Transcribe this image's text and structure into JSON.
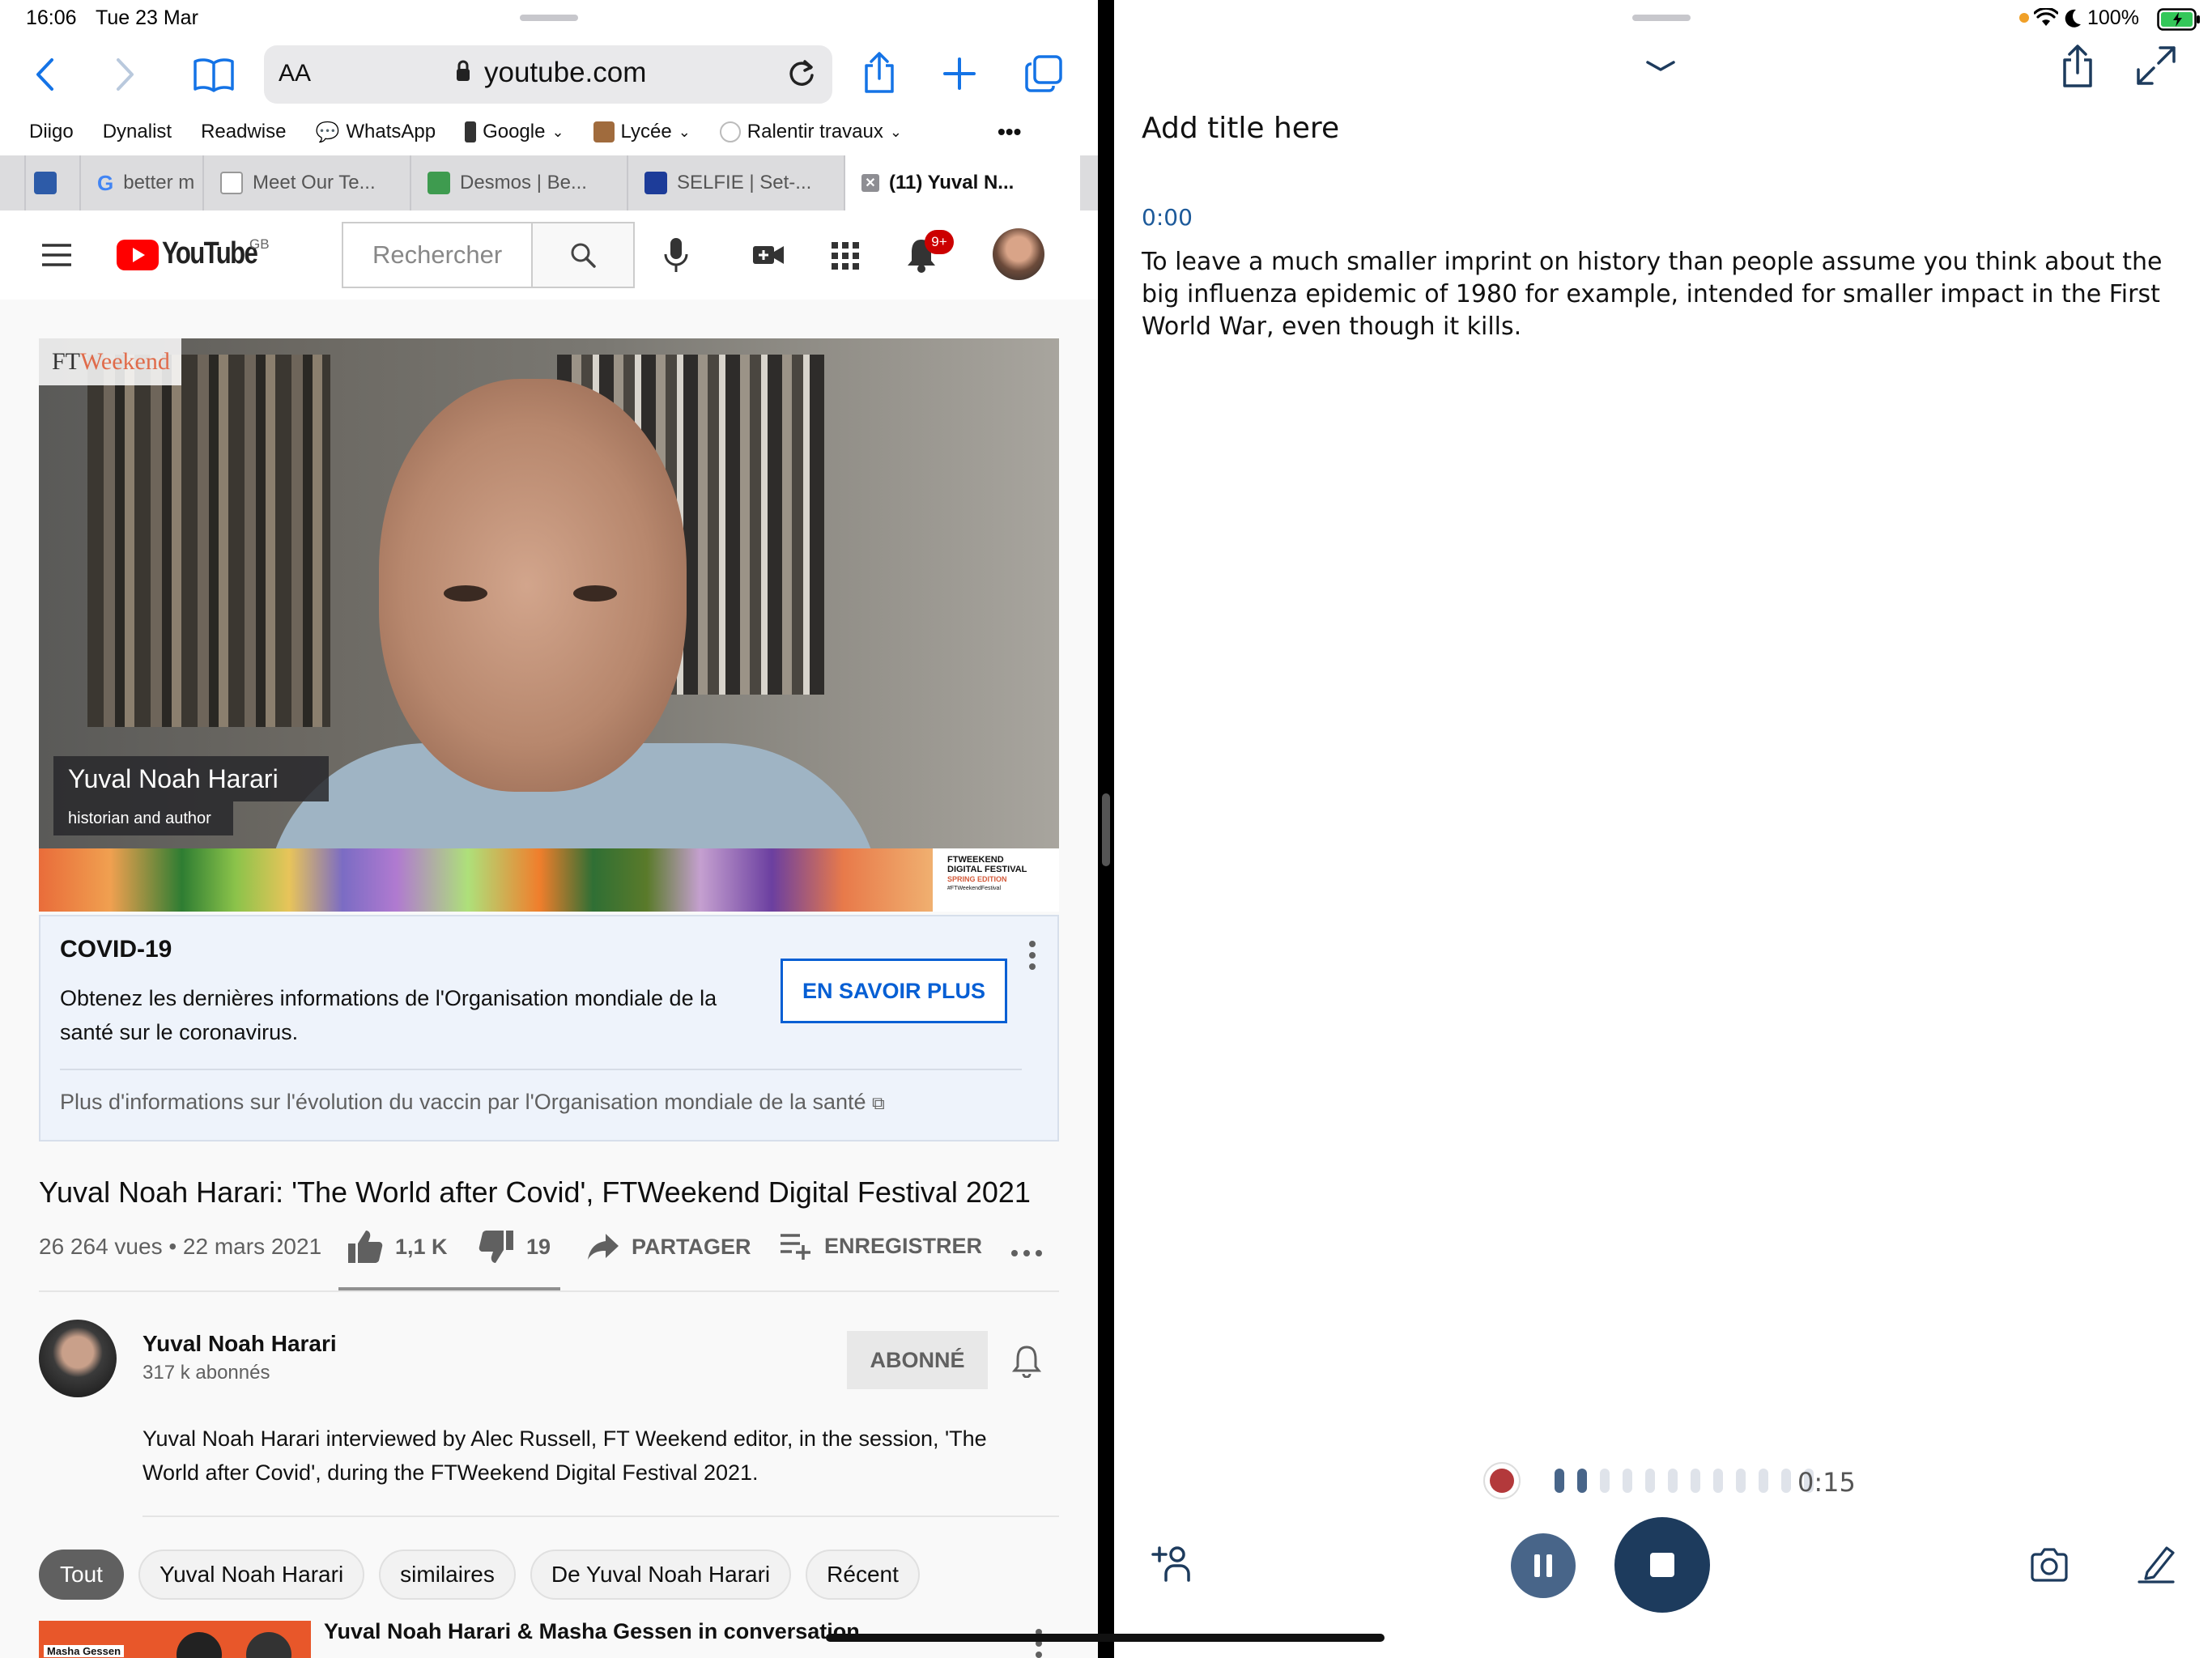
{
  "status": {
    "time": "16:06",
    "date": "Tue 23 Mar",
    "battery": "100%"
  },
  "safari": {
    "font_size_button": "AA",
    "url": "youtube.com",
    "bookmarks": [
      "Diigo",
      "Dynalist",
      "Readwise",
      "WhatsApp",
      "Google",
      "Lycée",
      "Ralentir travaux"
    ],
    "more": "•••",
    "tabs": [
      "better m",
      "Meet Our Te...",
      "Desmos | Be...",
      "SELFIE | Set-...",
      "(11) Yuval N..."
    ]
  },
  "youtube": {
    "logo": "YouTube",
    "region": "GB",
    "search_placeholder": "Rechercher",
    "notifications_badge": "9+",
    "video": {
      "brand": "FT",
      "brand2": "Weekend",
      "lower_third_name": "Yuval Noah Harari",
      "lower_third_role": "historian and author",
      "festival_lines": [
        "FTWEEKEND",
        "DIGITAL FESTIVAL",
        "SPRING EDITION",
        "#FTWeekendFestival"
      ]
    },
    "covid": {
      "title": "COVID-19",
      "text": "Obtenez les dernières informations de l'Organisation mondiale de la santé sur le coronavirus.",
      "button": "EN SAVOIR PLUS",
      "link": "Plus d'informations sur l'évolution du vaccin par l'Organisation mondiale de la santé"
    },
    "video_title": "Yuval Noah Harari: 'The World after Covid', FTWeekend Digital Festival 2021",
    "views_date": "26 264 vues • 22 mars 2021",
    "likes": "1,1 K",
    "dislikes": "19",
    "share": "PARTAGER",
    "save": "ENREGISTRER",
    "channel": {
      "name": "Yuval Noah Harari",
      "subscribers": "317 k abonnés",
      "subscribe_button": "ABONNÉ"
    },
    "description": "Yuval Noah Harari interviewed by Alec Russell, FT Weekend editor, in the session, 'The World after Covid', during the FTWeekend Digital Festival 2021.",
    "chips": [
      "Tout",
      "Yuval Noah Harari",
      "similaires",
      "De Yuval Noah Harari",
      "Récent"
    ],
    "next_video_title": "Yuval Noah Harari & Masha Gessen in conversation",
    "next_thumb_label": "Masha Gessen"
  },
  "recorder": {
    "title_placeholder": "Add title here",
    "timestamp": "0:00",
    "transcript": "To leave a much smaller imprint on history than people assume you think about the big influenza epidemic of 1980 for example, intended for smaller impact in the First World War, even though it kills.",
    "elapsed": "0:15",
    "level_fraction": 0.17
  },
  "colors": {
    "safari_blue": "#1473e6",
    "youtube_red": "#ff0000",
    "youtube_link_blue": "#065fd4",
    "recorder_navy": "#1d3b5d",
    "record_red": "#b3393b"
  }
}
